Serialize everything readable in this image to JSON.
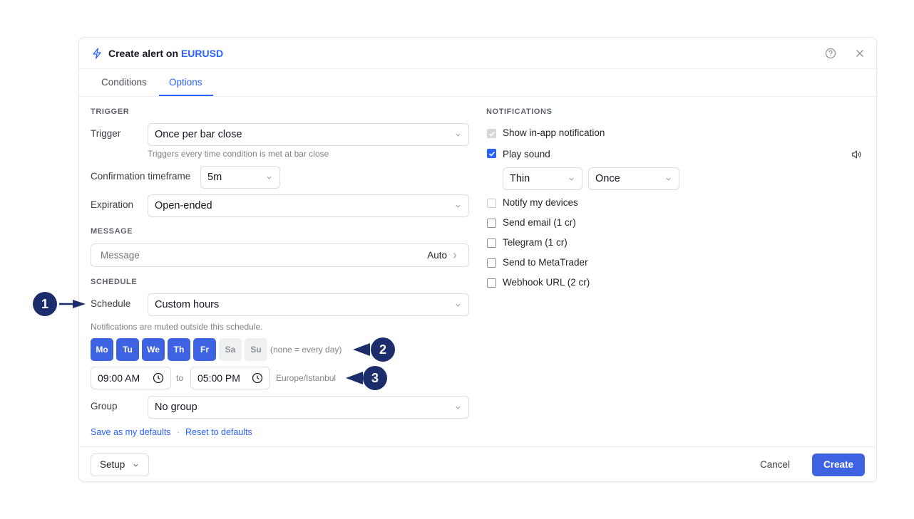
{
  "dialog": {
    "title_prefix": "Create alert on ",
    "symbol": "EURUSD",
    "icons": {
      "title": "bolt-icon",
      "help": "help-circle-icon",
      "close": "close-icon"
    }
  },
  "tabs": [
    {
      "label": "Conditions",
      "active": false
    },
    {
      "label": "Options",
      "active": true
    }
  ],
  "trigger": {
    "section": "TRIGGER",
    "label": "Trigger",
    "value": "Once per bar close",
    "hint": "Triggers every time condition is met at bar close",
    "confirmation_label": "Confirmation timeframe",
    "confirmation_value": "5m",
    "expiration_label": "Expiration",
    "expiration_value": "Open-ended"
  },
  "message": {
    "section": "MESSAGE",
    "placeholder": "Message",
    "mode": "Auto"
  },
  "schedule": {
    "section": "SCHEDULE",
    "label": "Schedule",
    "value": "Custom hours",
    "hint": "Notifications are muted outside this schedule.",
    "days": [
      {
        "label": "Mo",
        "on": true
      },
      {
        "label": "Tu",
        "on": true
      },
      {
        "label": "We",
        "on": true
      },
      {
        "label": "Th",
        "on": true
      },
      {
        "label": "Fr",
        "on": true
      },
      {
        "label": "Sa",
        "on": false
      },
      {
        "label": "Su",
        "on": false
      }
    ],
    "days_note": "(none = every day)",
    "from": "09:00 AM",
    "to_label": "to",
    "to": "05:00 PM",
    "timezone": "Europe/Istanbul"
  },
  "group": {
    "label": "Group",
    "value": "No group"
  },
  "defaults": {
    "save": "Save as my defaults",
    "separator": "·",
    "reset": "Reset to defaults"
  },
  "notifications": {
    "section": "NOTIFICATIONS",
    "in_app": {
      "label": "Show in-app notification",
      "checked": true,
      "disabled": true
    },
    "sound": {
      "label": "Play sound",
      "checked": true,
      "sound_value": "Thin",
      "repeat_value": "Once"
    },
    "devices": {
      "label": "Notify my devices",
      "checked": false,
      "disabled": true
    },
    "email": {
      "label": "Send email (1 cr)",
      "checked": false
    },
    "telegram": {
      "label": "Telegram (1 cr)",
      "checked": false
    },
    "metatrader": {
      "label": "Send to MetaTrader",
      "checked": false
    },
    "webhook": {
      "label": "Webhook URL (2 cr)",
      "checked": false
    }
  },
  "footer": {
    "setup": "Setup",
    "cancel": "Cancel",
    "create": "Create"
  },
  "markers": [
    "1",
    "2",
    "3"
  ],
  "colors": {
    "accent": "#2962ff",
    "primary_button": "#3d63e3",
    "marker": "#1b2d6b"
  }
}
